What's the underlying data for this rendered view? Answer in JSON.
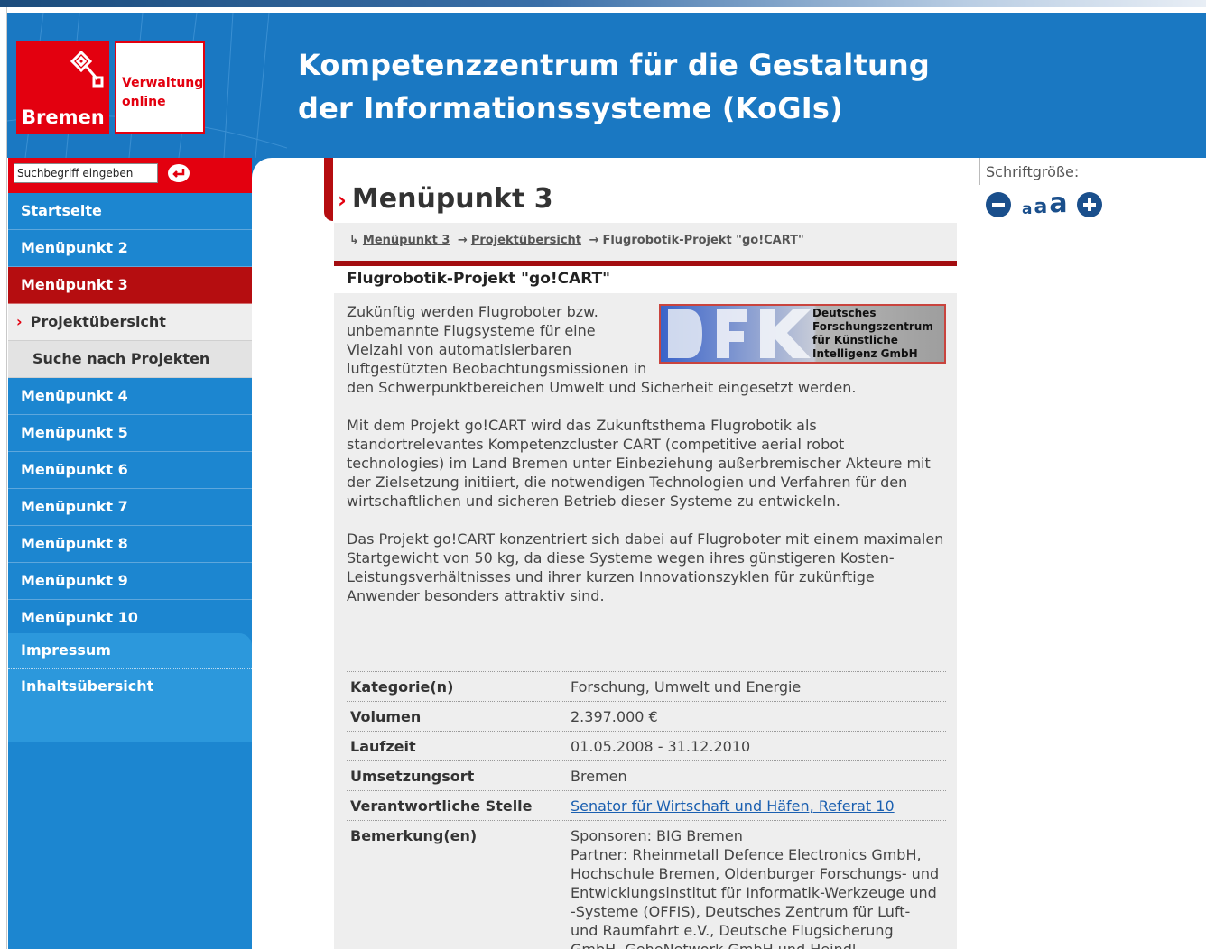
{
  "header": {
    "logo_city": "Bremen",
    "logo_service_line1": "Verwaltung",
    "logo_service_line2": "online",
    "title_line1": "Kompetenzzentrum für die Gestaltung",
    "title_line2": "der Informationssysteme (KoGIs)"
  },
  "search": {
    "value": "Suchbegriff eingeben"
  },
  "sidebar": {
    "items": [
      {
        "label": "Startseite"
      },
      {
        "label": "Menüpunkt 2"
      },
      {
        "label": "Menüpunkt 3"
      },
      {
        "label": "Projektübersicht"
      },
      {
        "label": "Suche nach Projekten"
      },
      {
        "label": "Menüpunkt 4"
      },
      {
        "label": "Menüpunkt 5"
      },
      {
        "label": "Menüpunkt 6"
      },
      {
        "label": "Menüpunkt 7"
      },
      {
        "label": "Menüpunkt 8"
      },
      {
        "label": "Menüpunkt 9"
      },
      {
        "label": "Menüpunkt 10"
      }
    ],
    "footer_items": [
      {
        "label": "Impressum"
      },
      {
        "label": "Inhaltsübersicht"
      }
    ]
  },
  "page": {
    "heading": "Menüpunkt 3",
    "breadcrumb": [
      "Menüpunkt 3",
      "Projektübersicht",
      "Flugrobotik-Projekt \"go!CART\""
    ],
    "article_title": "Flugrobotik-Projekt \"go!CART\"",
    "partner_logo": {
      "line1": "Deutsches",
      "line2": "Forschungszentrum",
      "line3": "für Künstliche",
      "line4": "Intelligenz GmbH"
    },
    "paragraphs": [
      "Zukünftig werden Flugroboter bzw. unbemannte Flugsysteme für eine Vielzahl von automatisierbaren luftgestützten Beobachtungsmissionen in den Schwerpunktbereichen Umwelt und Sicherheit eingesetzt werden.",
      "Mit dem Projekt go!CART wird das Zukunftsthema Flugrobotik als standortrelevantes Kompetenzcluster CART (competitive aerial robot technologies) im Land Bremen unter Einbeziehung außerbremischer Akteure mit der Zielsetzung initiiert, die notwendigen Technologien und Verfahren für den wirtschaftlichen und sicheren Betrieb dieser Systeme zu entwickeln.",
      "Das Projekt go!CART konzentriert sich dabei auf Flugroboter mit einem maximalen Startgewicht von 50 kg, da diese Systeme wegen ihres günstigeren Kosten-Leistungsverhältnisses und ihrer kurzen Innovationszyklen für zukünftige Anwender besonders attraktiv sind."
    ],
    "info": {
      "kategorie_label": "Kategorie(n)",
      "kategorie": "Forschung, Umwelt und Energie",
      "volumen_label": "Volumen",
      "volumen": "2.397.000 €",
      "laufzeit_label": "Laufzeit",
      "laufzeit": "01.05.2008 - 31.12.2010",
      "ort_label": "Umsetzungsort",
      "ort": "Bremen",
      "stelle_label": "Verantwortliche Stelle",
      "stelle": "Senator für Wirtschaft und Häfen, Referat 10",
      "bemerkung_label": "Bemerkung(en)",
      "bemerkung_line1": "Sponsoren: BIG Bremen",
      "bemerkung_line2": "Partner: Rheinmetall Defence Electronics GmbH, Hochschule Bremen, Oldenburger Forschungs- und Entwicklungsinstitut für Informatik-Werkzeuge und -Systeme (OFFIS), Deutsches Zentrum für Luft- und Raumfahrt e.V., Deutsche Flugsicherung GmbH, GeheNetwork GmbH und Heindl"
    }
  },
  "font_size": {
    "label": "Schriftgröße:",
    "small": "a",
    "medium": "a",
    "large": "a"
  },
  "colors": {
    "brand_blue": "#1a78c2",
    "brand_red": "#e3000f",
    "active_red": "#b50d10",
    "link_blue": "#1a5fb0"
  },
  "icons": {
    "search_submit": "enter-arrow-icon",
    "decrease_font": "minus-circle-icon",
    "increase_font": "plus-circle-icon",
    "crumb_start": "return-arrow-icon",
    "crumb_sep": "right-arrow-icon",
    "heading_marker": "chevron-right-icon",
    "logo_key": "bremen-key-icon"
  }
}
